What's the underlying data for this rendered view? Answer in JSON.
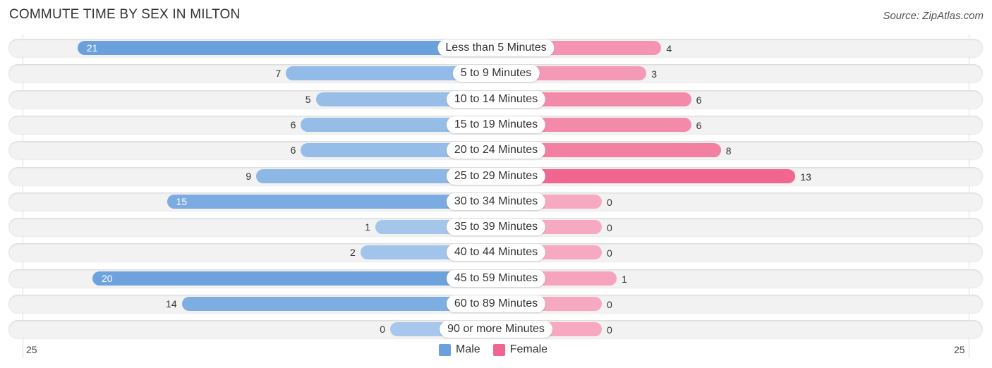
{
  "title": "COMMUTE TIME BY SEX IN MILTON",
  "source": "Source: ZipAtlas.com",
  "colors": {
    "male": "#6aa0dc",
    "male_light": "#a7c8ec",
    "female": "#f06690",
    "female_light": "#f7a9c1"
  },
  "chart_data": {
    "type": "bar",
    "orientation": "horizontal-diverging",
    "title": "COMMUTE TIME BY SEX IN MILTON",
    "categories": [
      "Less than 5 Minutes",
      "5 to 9 Minutes",
      "10 to 14 Minutes",
      "15 to 19 Minutes",
      "20 to 24 Minutes",
      "25 to 29 Minutes",
      "30 to 34 Minutes",
      "35 to 39 Minutes",
      "40 to 44 Minutes",
      "45 to 59 Minutes",
      "60 to 89 Minutes",
      "90 or more Minutes"
    ],
    "series": [
      {
        "name": "Male",
        "values": [
          21,
          7,
          5,
          6,
          6,
          9,
          15,
          1,
          2,
          20,
          14,
          0
        ]
      },
      {
        "name": "Female",
        "values": [
          4,
          3,
          6,
          6,
          8,
          13,
          0,
          0,
          0,
          1,
          0,
          0
        ]
      }
    ],
    "axis_ticks": {
      "left": "25",
      "right": "25"
    },
    "xlim": [
      -25,
      25
    ],
    "legend": {
      "position": "bottom-center",
      "entries": [
        "Male",
        "Female"
      ]
    },
    "grid": false
  }
}
